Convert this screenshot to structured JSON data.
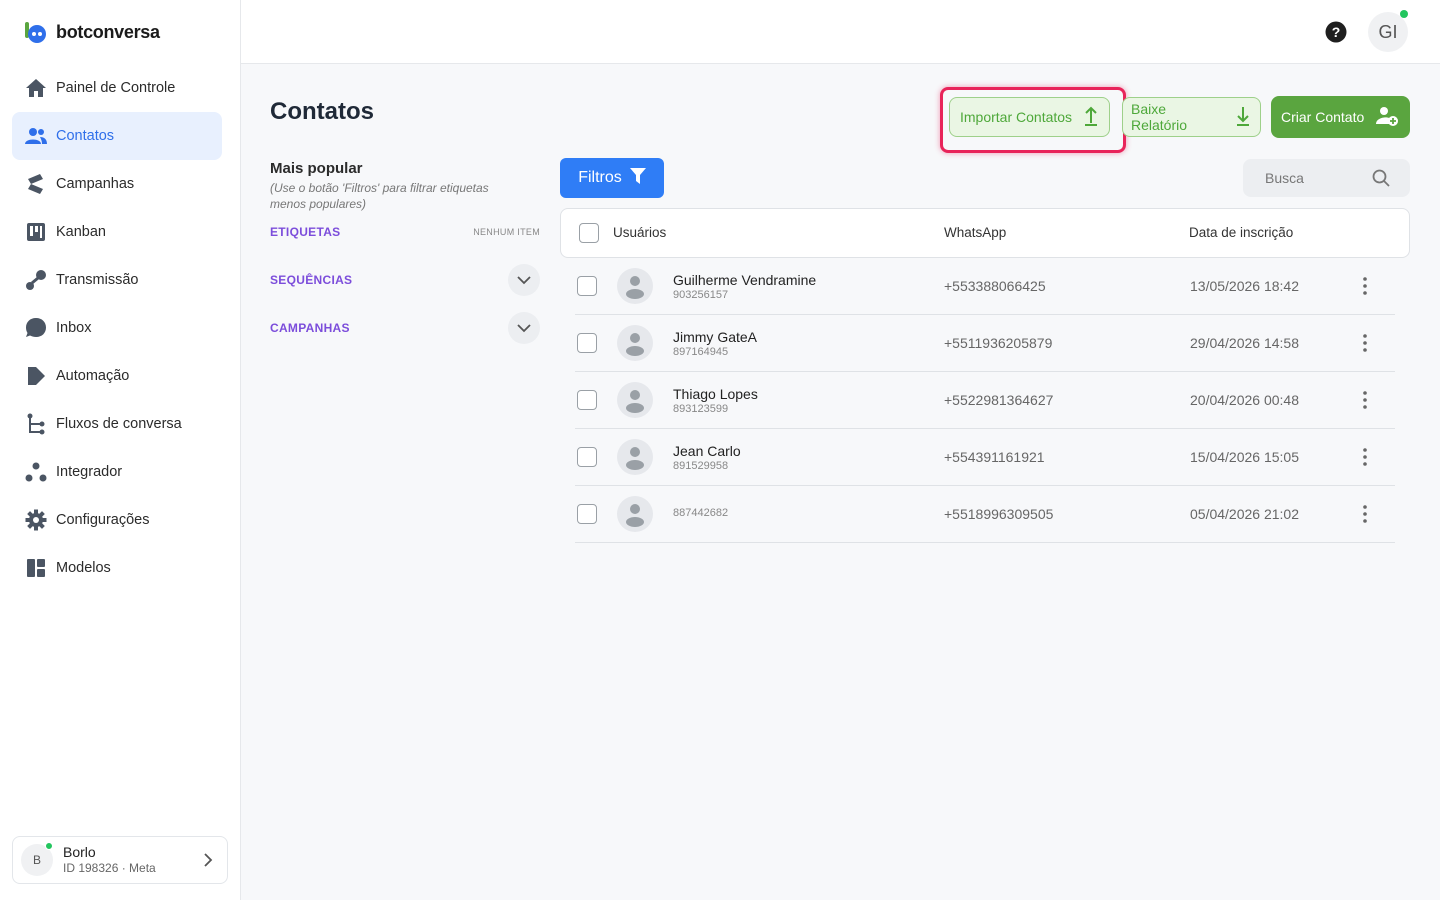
{
  "brand": {
    "name": "botconversa"
  },
  "sidebar": {
    "items": [
      {
        "label": "Painel de Controle",
        "icon": "home-icon"
      },
      {
        "label": "Contatos",
        "icon": "users-icon",
        "active": true
      },
      {
        "label": "Campanhas",
        "icon": "campaign-icon"
      },
      {
        "label": "Kanban",
        "icon": "kanban-icon"
      },
      {
        "label": "Transmissão",
        "icon": "broadcast-icon"
      },
      {
        "label": "Inbox",
        "icon": "chat-icon"
      },
      {
        "label": "Automação",
        "icon": "automation-icon"
      },
      {
        "label": "Fluxos de conversa",
        "icon": "flow-icon"
      },
      {
        "label": "Integrador",
        "icon": "integrator-icon"
      },
      {
        "label": "Configurações",
        "icon": "gear-icon"
      },
      {
        "label": "Modelos",
        "icon": "templates-icon"
      }
    ],
    "account": {
      "initial": "B",
      "name": "Borlo",
      "id_line": "ID 198326 · Meta"
    }
  },
  "topbar": {
    "user_initials": "GI"
  },
  "page": {
    "title": "Contatos",
    "buttons": {
      "import": "Importar Contatos",
      "report": "Baixe Relatório",
      "create": "Criar Contato"
    },
    "filters_label": "Filtros",
    "search_placeholder": "Busca"
  },
  "filter_panel": {
    "title": "Mais popular",
    "subtitle": "(Use o botão 'Filtros' para filtrar etiquetas menos populares)",
    "etiquetas": {
      "label": "ETIQUETAS",
      "empty": "NENHUM ITEM"
    },
    "sequencias": {
      "label": "SEQUÊNCIAS"
    },
    "campanhas": {
      "label": "CAMPANHAS"
    }
  },
  "table": {
    "headers": {
      "users": "Usuários",
      "whatsapp": "WhatsApp",
      "date": "Data de inscrição"
    },
    "rows": [
      {
        "name": "Guilherme Vendramine",
        "id": "903256157",
        "phone": "+553388066425",
        "date": "13/05/2026 18:42"
      },
      {
        "name": "Jimmy GateA",
        "id": "897164945",
        "phone": "+5511936205879",
        "date": "29/04/2026 14:58"
      },
      {
        "name": "Thiago Lopes",
        "id": "893123599",
        "phone": "+5522981364627",
        "date": "20/04/2026 00:48"
      },
      {
        "name": "Jean Carlo",
        "id": "891529958",
        "phone": "+554391161921",
        "date": "15/04/2026 15:05"
      },
      {
        "name": "",
        "id": "887442682",
        "phone": "+5518996309505",
        "date": "05/04/2026 21:02"
      }
    ]
  },
  "colors": {
    "primary": "#2f7df6",
    "green": "#5aa53f",
    "purple": "#7c4ddb",
    "highlight": "#e8245a",
    "active_nav_bg": "#e8f0fe"
  }
}
